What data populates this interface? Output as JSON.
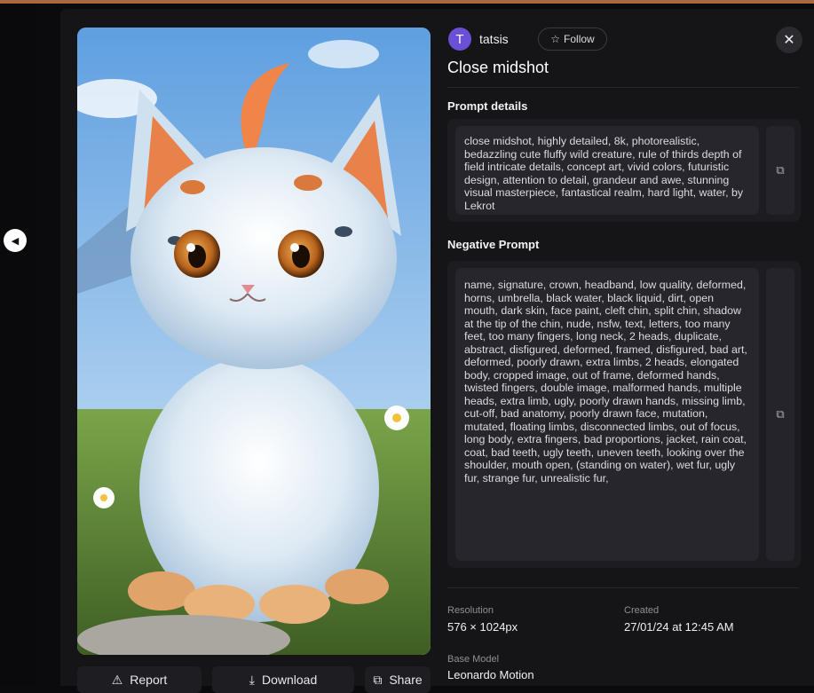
{
  "author": {
    "initial": "T",
    "name": "tatsis",
    "follow_label": "Follow"
  },
  "title": "Close midshot",
  "prompt": {
    "label": "Prompt details",
    "text": "close midshot, highly detailed, 8k, photorealistic, bedazzling cute fluffy wild creature, rule of thirds depth of field intricate details, concept art, vivid colors, futuristic design, attention to detail, grandeur and awe, stunning visual masterpiece, fantastical realm, hard light, water, by Lekrot"
  },
  "negative_prompt": {
    "label": "Negative Prompt",
    "text": "name, signature, crown, headband, low quality, deformed, horns, umbrella, black water, black liquid, dirt, open mouth, dark skin, face paint, cleft chin, split chin, shadow at the tip of the chin, nude, nsfw, text, letters, too many feet, too many fingers, long neck, 2 heads, duplicate, abstract, disfigured, deformed, framed, disfigured, bad art, deformed, poorly drawn, extra limbs, 2 heads, elongated body, cropped image, out of frame, deformed hands, twisted fingers, double image, malformed hands, multiple heads, extra limb, ugly, poorly drawn hands, missing limb, cut-off, bad anatomy, poorly drawn face, mutation, mutated, floating limbs, disconnected limbs, out of focus, long body, extra fingers, bad proportions, jacket, rain coat, coat, bad teeth, ugly teeth, uneven teeth, looking over the shoulder, mouth open, (standing on water), wet fur, ugly fur, strange fur, unrealistic fur,"
  },
  "meta": {
    "resolution_label": "Resolution",
    "resolution_value": "576 × 1024px",
    "created_label": "Created",
    "created_value": "27/01/24 at 12:45 AM",
    "model_label": "Base Model",
    "model_value": "Leonardo Motion"
  },
  "actions": {
    "report": "Report",
    "download": "Download",
    "share": "Share"
  },
  "icons": {
    "prev": "chevron-left-icon",
    "star": "star-icon",
    "close": "close-icon",
    "copy": "copy-icon",
    "warning": "warning-icon",
    "download": "download-icon",
    "share": "share-icon"
  },
  "colors": {
    "accent": "#6b4fd6",
    "background": "#151518",
    "panel": "#1c1c21"
  }
}
